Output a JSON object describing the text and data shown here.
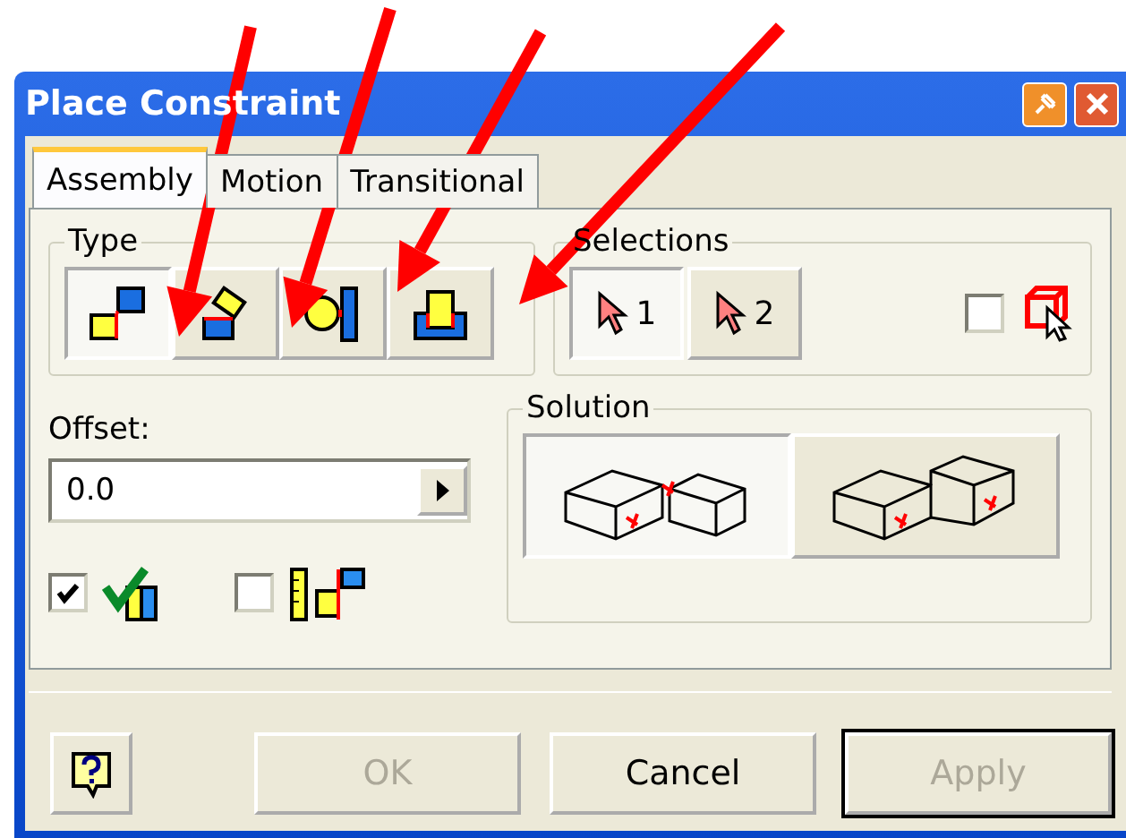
{
  "window": {
    "title": "Place Constraint"
  },
  "tabs": [
    {
      "label": "Assembly",
      "selected": true
    },
    {
      "label": "Motion",
      "selected": false
    },
    {
      "label": "Transitional",
      "selected": false
    }
  ],
  "type_group": {
    "title": "Type",
    "buttons": [
      {
        "kind": "mate",
        "selected": true
      },
      {
        "kind": "angle",
        "selected": false
      },
      {
        "kind": "tangent",
        "selected": false
      },
      {
        "kind": "insert",
        "selected": false
      }
    ]
  },
  "selections_group": {
    "title": "Selections",
    "buttons": [
      {
        "label": "1",
        "selected": true
      },
      {
        "label": "2",
        "selected": false
      }
    ],
    "pick_part_first": {
      "checked": false
    }
  },
  "offset": {
    "label": "Offset:",
    "value": "0.0"
  },
  "options": [
    {
      "kind": "preview",
      "checked": true
    },
    {
      "kind": "predict",
      "checked": false
    }
  ],
  "solution_group": {
    "title": "Solution",
    "buttons": [
      {
        "kind": "mate",
        "selected": true
      },
      {
        "kind": "flush",
        "selected": false
      }
    ]
  },
  "buttons": [
    {
      "label": "OK",
      "disabled": true,
      "default": false
    },
    {
      "label": "Cancel",
      "disabled": false,
      "default": false
    },
    {
      "label": "Apply",
      "disabled": true,
      "default": true
    }
  ],
  "annotations": [
    {
      "kind": "arrow"
    },
    {
      "kind": "arrow"
    },
    {
      "kind": "arrow"
    },
    {
      "kind": "arrow"
    }
  ]
}
